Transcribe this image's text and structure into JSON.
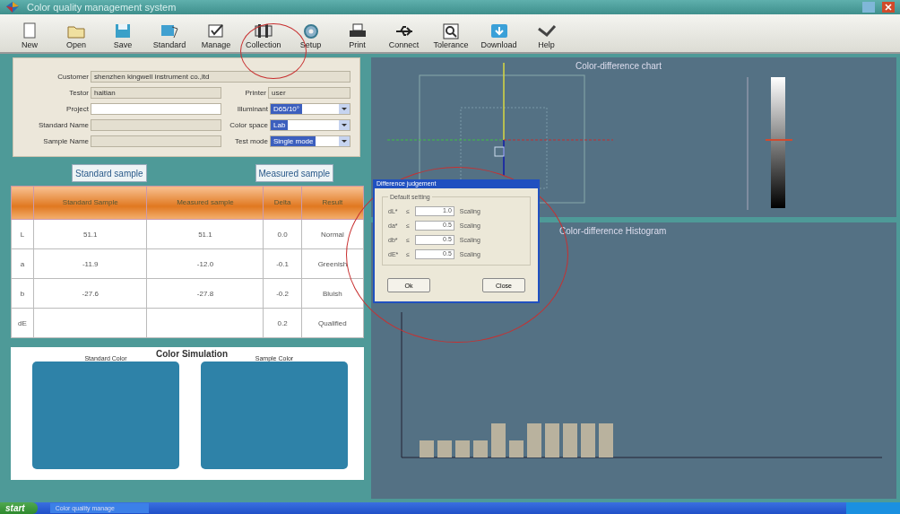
{
  "window": {
    "title": "Color quality management system"
  },
  "toolbar": [
    "New",
    "Open",
    "Save",
    "Standard",
    "Manage",
    "Collection",
    "Setup",
    "Print",
    "Connect",
    "Tolerance",
    "Download",
    "Help"
  ],
  "form": {
    "fields": [
      {
        "label": "Customer",
        "value": "shenzhen kingwell instrument co.,ltd",
        "wide": true,
        "kind": "text"
      },
      {
        "label": "Testor",
        "value": "haitian",
        "kind": "text"
      },
      {
        "label": "Printer",
        "value": "user",
        "kind": "text"
      },
      {
        "label": "Project",
        "kind": "text",
        "editable": true
      },
      {
        "label": "Illuminant",
        "value": "D65/10°",
        "kind": "select"
      },
      {
        "label": "Standard Name",
        "kind": "text"
      },
      {
        "label": "Color space",
        "value": "Lab",
        "kind": "select"
      },
      {
        "label": "Sample Name",
        "kind": "text"
      },
      {
        "label": "Test mode",
        "value": "Single mode",
        "kind": "select"
      }
    ]
  },
  "sample_buttons": [
    "Standard sample",
    "Measured sample"
  ],
  "table": {
    "columns": [
      "",
      "Standard Sample",
      "Measured sample",
      "Delta",
      "Result"
    ],
    "rows": [
      [
        "L",
        "51.1",
        "51.1",
        "0.0",
        "Normal"
      ],
      [
        "a",
        "-11.9",
        "-12.0",
        "-0.1",
        "Greenish"
      ],
      [
        "b",
        "-27.6",
        "-27.8",
        "-0.2",
        "Bluish"
      ],
      [
        "dE",
        "",
        "",
        "0.2",
        "Qualified"
      ]
    ]
  },
  "color_simulation": {
    "title": "Color Simulation",
    "swatches": [
      {
        "label": "Standard Color",
        "color": "#2e82a8"
      },
      {
        "label": "Sample Color",
        "color": "#2e82a8"
      }
    ]
  },
  "chart": {
    "title": "Color-difference chart"
  },
  "histogram": {
    "title": "Color-difference Histogram"
  },
  "dialog": {
    "title": "Difference judgement",
    "group": "Default setting",
    "rows": [
      {
        "label": "dL*",
        "op": "≤",
        "value": "1.0",
        "unit": "Scaling"
      },
      {
        "label": "da*",
        "op": "≤",
        "value": "0.5",
        "unit": "Scaling"
      },
      {
        "label": "db*",
        "op": "≤",
        "value": "0.5",
        "unit": "Scaling"
      },
      {
        "label": "dE*",
        "op": "≤",
        "value": "0.5",
        "unit": "Scaling"
      }
    ],
    "buttons": [
      "Ok",
      "Close"
    ]
  },
  "taskbar": {
    "start": "start",
    "task": "Color quality manage"
  }
}
